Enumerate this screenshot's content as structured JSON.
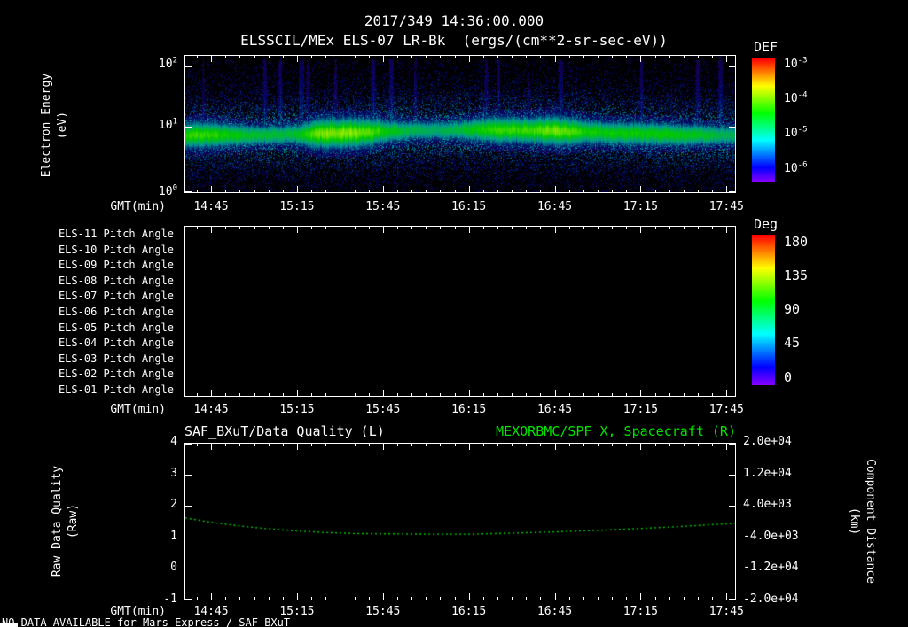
{
  "colors": {
    "background": "#000000",
    "foreground": "#ffffff",
    "green_text": "#00e400",
    "line_green": "#00c800"
  },
  "header": {
    "timestamp": "2017/349 14:36:00.000",
    "title": "ELSSCIL/MEx ELS-07 LR-Bk  (ergs/(cm**2-sr-sec-eV))"
  },
  "time_axis": {
    "label": "GMT(min)",
    "start": "14:36",
    "end": "17:48",
    "ticks": [
      "14:45",
      "15:15",
      "15:45",
      "16:15",
      "16:45",
      "17:15",
      "17:45"
    ]
  },
  "footer": {
    "no_data_text": "NO DATA AVAILABLE for Mars Express / SAF_BXuT"
  },
  "chart_data": [
    {
      "id": "electron_energy_spectrogram",
      "type": "heatmap",
      "title": "ELSSCIL/MEx ELS-07 LR-Bk",
      "units": "ergs/(cm**2-sr-sec-eV)",
      "ylabel": "Electron Energy\n(eV)",
      "y_scale": "log",
      "ylim": [
        "1e0",
        "1e2"
      ],
      "y_ticks": [
        {
          "base": "10",
          "exp": "2",
          "frac": 0.08
        },
        {
          "base": "10",
          "exp": "1",
          "frac": 0.52
        },
        {
          "base": "10",
          "exp": "0",
          "frac": 1.0
        }
      ],
      "colorbar": {
        "label": "DEF",
        "scale": "log",
        "range": [
          "1e-6",
          "1e-3"
        ],
        "ticks": [
          {
            "base": "10",
            "exp": "-3",
            "frac": 0.05
          },
          {
            "base": "10",
            "exp": "-4",
            "frac": 0.33
          },
          {
            "base": "10",
            "exp": "-5",
            "frac": 0.61
          },
          {
            "base": "10",
            "exp": "-6",
            "frac": 0.89
          }
        ],
        "colormap_stops": [
          "#ff0000",
          "#ff9900",
          "#ffff00",
          "#00ff00",
          "#00ffff",
          "#0000ff",
          "#7a00c8"
        ]
      },
      "summary": "Continuous bright electron-flux band centered near 10 eV (DEF ~1e-4, green) across 14:36-17:48; brightest yellow-green enhancements ~15:10-15:50 and ~16:30-16:50; sparse blue/violet background counts (~1e-6) above and below the band with occasional vertical enhancement streaks reaching 100 eV."
    },
    {
      "id": "pitch_angle_panels",
      "type": "heatmap",
      "row_labels": [
        "ELS-11 Pitch Angle",
        "ELS-10 Pitch Angle",
        "ELS-09 Pitch Angle",
        "ELS-08 Pitch Angle",
        "ELS-07 Pitch Angle",
        "ELS-06 Pitch Angle",
        "ELS-05 Pitch Angle",
        "ELS-04 Pitch Angle",
        "ELS-03 Pitch Angle",
        "ELS-02 Pitch Angle",
        "ELS-01 Pitch Angle"
      ],
      "colorbar": {
        "label": "Deg",
        "range": [
          0,
          180
        ],
        "ticks": [
          {
            "value": "180",
            "frac": 0.05
          },
          {
            "value": "135",
            "frac": 0.275
          },
          {
            "value": "90",
            "frac": 0.5
          },
          {
            "value": "45",
            "frac": 0.725
          },
          {
            "value": "0",
            "frac": 0.95
          }
        ],
        "colormap_stops": [
          "#ff0000",
          "#ff9900",
          "#ffff00",
          "#00ff00",
          "#00ffff",
          "#0000ff",
          "#7a00c8"
        ]
      },
      "summary": "Empty panel - no pitch angle data plotted."
    },
    {
      "id": "data_quality_and_spacecraft_x",
      "type": "line",
      "title_left": "SAF_BXuT/Data Quality (L)",
      "title_right": "MEXORBMC/SPF X, Spacecraft (R)",
      "ylabel_left": "Raw Data Quality\n(Raw)",
      "ylim_left": [
        -1,
        4
      ],
      "yticks_left": [
        "4",
        "3",
        "2",
        "1",
        "0",
        "-1"
      ],
      "ylabel_right": "Component Distance\n(km)",
      "ylim_right": [
        -20000,
        20000
      ],
      "yticks_right": [
        "2.0e+04",
        "1.2e+04",
        "4.0e+03",
        "-4.0e+03",
        "-1.2e+04",
        "-2.0e+04"
      ],
      "grid": false,
      "series": [
        {
          "name": "MEXORBMC/SPF X Spacecraft (right axis)",
          "style": "dotted",
          "x": [
            "14:36",
            "14:45",
            "14:55",
            "15:05",
            "15:15",
            "15:25",
            "15:35",
            "15:45",
            "16:00",
            "16:15",
            "16:30",
            "16:45",
            "17:00",
            "17:15",
            "17:30",
            "17:45",
            "17:48"
          ],
          "y_left_axis_units": [
            1.62,
            1.48,
            1.36,
            1.27,
            1.2,
            1.15,
            1.12,
            1.11,
            1.1,
            1.1,
            1.13,
            1.17,
            1.22,
            1.28,
            1.35,
            1.43,
            1.45
          ],
          "y_km": [
            960,
            -160,
            -1120,
            -1840,
            -2400,
            -2800,
            -3040,
            -3120,
            -3200,
            -3200,
            -2960,
            -2640,
            -2240,
            -1760,
            -1200,
            -560,
            -400
          ]
        }
      ]
    }
  ]
}
